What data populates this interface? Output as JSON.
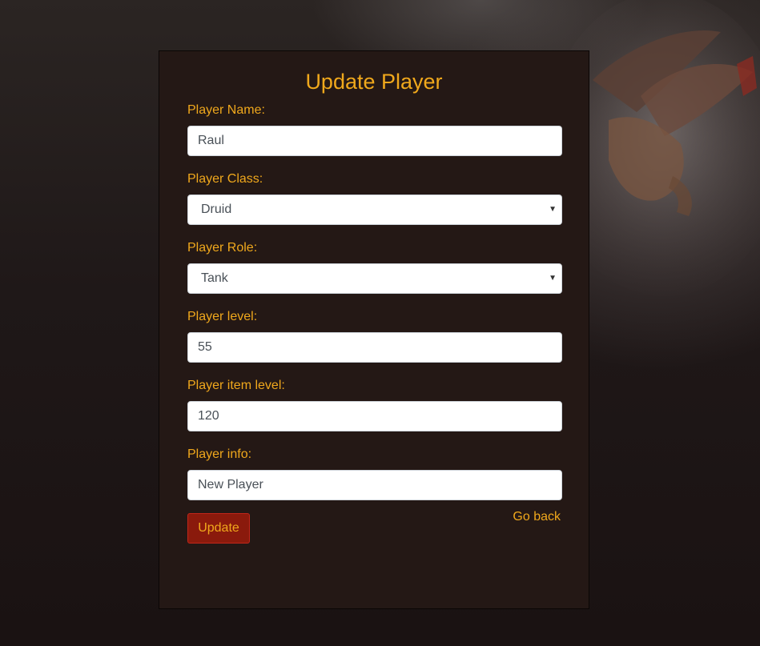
{
  "form": {
    "title": "Update Player",
    "name_label": "Player Name:",
    "name_value": "Raul",
    "class_label": "Player Class:",
    "class_value": "Druid",
    "role_label": "Player Role:",
    "role_value": "Tank",
    "level_label": "Player level:",
    "level_value": "55",
    "item_level_label": "Player item level:",
    "item_level_value": "120",
    "info_label": "Player info:",
    "info_value": "New Player",
    "update_label": "Update",
    "back_label": "Go back"
  },
  "icons": {
    "select_arrow": "chevron-down-icon"
  },
  "colors": {
    "accent": "#f0a81c",
    "card_background": "#241815",
    "button_background": "#8a1a0c"
  }
}
